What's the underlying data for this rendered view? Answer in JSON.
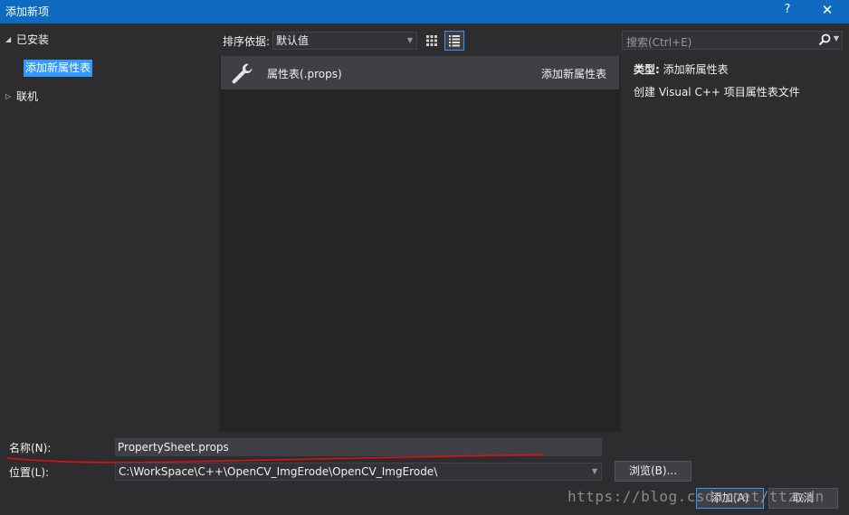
{
  "window": {
    "title": "添加新项",
    "help_glyph": "?",
    "close_glyph": "✕"
  },
  "tree": {
    "installed_label": "已安装",
    "selected_item": "添加新属性表",
    "online_label": "联机"
  },
  "sort": {
    "label": "排序依据:",
    "value": "默认值"
  },
  "templates": [
    {
      "name": "属性表(.props)",
      "category": "添加新属性表",
      "icon": "wrench-icon"
    }
  ],
  "search": {
    "placeholder": "搜索(Ctrl+E)"
  },
  "details": {
    "type_label": "类型:",
    "type_value": "添加新属性表",
    "description": "创建 Visual C++ 项目属性表文件"
  },
  "form": {
    "name_label": "名称(N):",
    "name_value": "PropertySheet.props",
    "location_label": "位置(L):",
    "location_value": "C:\\WorkSpace\\C++\\OpenCV_ImgErode\\OpenCV_ImgErode\\",
    "browse_label": "浏览(B)...",
    "add_label": "添加(A)",
    "cancel_label": "取消"
  },
  "watermark": "https://blog.csdn.net/ttzsdn",
  "colors": {
    "titlebar": "#0e6bbf",
    "accent": "#3399ff",
    "underline": "#e01010"
  }
}
